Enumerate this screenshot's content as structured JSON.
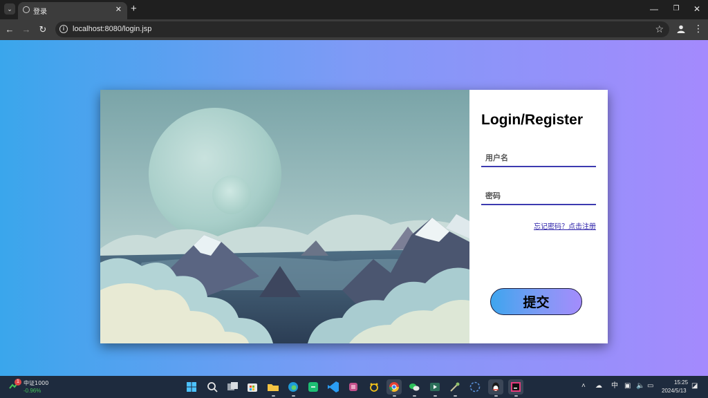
{
  "browser": {
    "tab": {
      "title": "登录",
      "favicon": "globe-icon"
    },
    "url": "localhost:8080/login.jsp",
    "buttons": [
      "back-icon",
      "forward-icon",
      "reload-icon",
      "star-icon",
      "profile-icon",
      "menu-icon"
    ],
    "window_controls": [
      "minimize-icon",
      "restore-icon",
      "close-icon"
    ]
  },
  "page": {
    "background_gradient": [
      "#3aa6ec",
      "#a48afd"
    ],
    "login": {
      "title": "Login/Register",
      "username_placeholder": "用户名",
      "password_placeholder": "密码",
      "forgot_link": "忘记密码？点击注册",
      "submit_label": "提交"
    }
  },
  "taskbar": {
    "stock": {
      "name": "中证1000",
      "change": "-0.96%",
      "badge": "1"
    },
    "apps": [
      "windows-start-icon",
      "search-icon",
      "task-view-icon",
      "store-icon",
      "file-explorer-icon",
      "edge-icon",
      "wechat-work-icon",
      "vscode-icon",
      "app-icon",
      "baidu-icon",
      "chrome-icon",
      "wechat-icon",
      "media-icon",
      "sword-icon",
      "steam-icon",
      "qq-icon",
      "intellij-icon"
    ],
    "tray": {
      "ime": "中"
    },
    "clock": {
      "time": "15:25",
      "date": "2024/5/13"
    }
  }
}
